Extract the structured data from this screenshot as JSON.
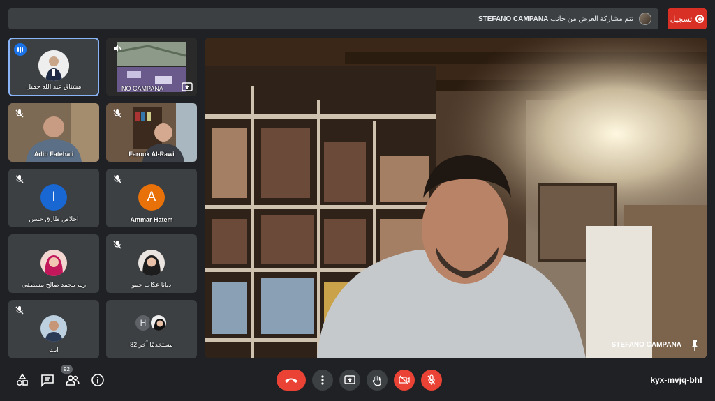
{
  "top_bar": {
    "presenter": "STEFANO CAMPANA",
    "presenting_message": "تتم مشاركة العرض من جانب",
    "record_label": "تسجيل"
  },
  "tiles": [
    {
      "name": "مشتاق عبد الله جميل"
    },
    {
      "name": "NO CAMPANA"
    },
    {
      "name": "Adib Fatehali"
    },
    {
      "name": "Farouk Al-Rawi"
    },
    {
      "name": "اخلاص طارق حسن",
      "initial": "I",
      "color": "#1967d2"
    },
    {
      "name": "Ammar Hatem",
      "initial": "A",
      "color": "#e8710a"
    },
    {
      "name": "ريم محمد صالح مسطفى"
    },
    {
      "name": "ديانا عكاب حمو"
    },
    {
      "name": "انت"
    },
    {
      "name": "82 مستخدمًا آخر",
      "initial": "H",
      "color": "#3c4043"
    }
  ],
  "main_speaker": {
    "name": "STEFANO CAMPANA"
  },
  "bottom_bar": {
    "participants_count": "92",
    "meeting_code": "kyx-mvjq-bhf"
  },
  "colors": {
    "background": "#202124",
    "tile": "#3c4043",
    "danger": "#ea4335",
    "accent": "#1a73e8"
  }
}
